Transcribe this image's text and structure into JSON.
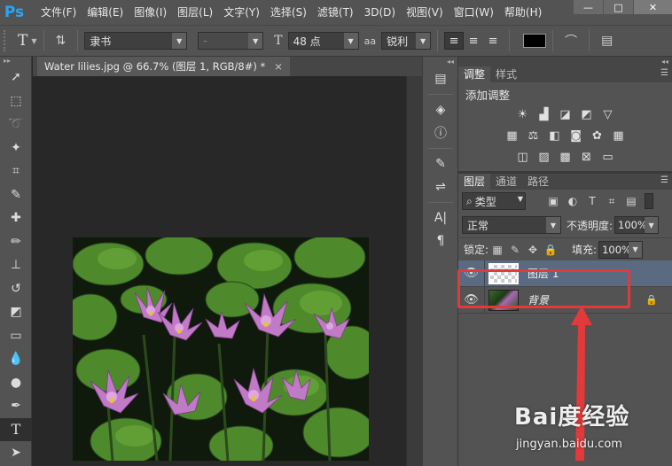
{
  "app": {
    "logo": "Ps",
    "menu": [
      "文件(F)",
      "编辑(E)",
      "图像(I)",
      "图层(L)",
      "文字(Y)",
      "选择(S)",
      "滤镜(T)",
      "3D(D)",
      "视图(V)",
      "窗口(W)",
      "帮助(H)"
    ],
    "window_buttons": {
      "minimize": "—",
      "restore": "□",
      "close": "✕"
    }
  },
  "options_bar": {
    "font_family": "隶书",
    "font_style": "-",
    "font_size": "48 点",
    "aa_label": "aa",
    "antialias": "锐利",
    "text_color": "#000000"
  },
  "document": {
    "tab_title": "Water lilies.jpg @ 66.7% (图层 1, RGB/8#) *",
    "tab_close": "×"
  },
  "adjustments_panel": {
    "tabs": [
      "调整",
      "样式"
    ],
    "title": "添加调整"
  },
  "layers_panel": {
    "tabs": [
      "图层",
      "通道",
      "路径"
    ],
    "filter_label": "类型",
    "blend_mode": "正常",
    "opacity_label": "不透明度:",
    "opacity_value": "100%",
    "lock_label": "锁定:",
    "fill_label": "填充:",
    "fill_value": "100%",
    "layers": [
      {
        "name": "图层 1",
        "selected": true
      },
      {
        "name": "背景",
        "selected": false,
        "locked": true
      }
    ]
  },
  "watermark": {
    "main": "Bai度经验",
    "sub": "jingyan.baidu.com"
  },
  "colors": {
    "accent_logo": "#2aa4f4",
    "selection": "#5a6a80",
    "annotation_red": "#e23a3a"
  }
}
